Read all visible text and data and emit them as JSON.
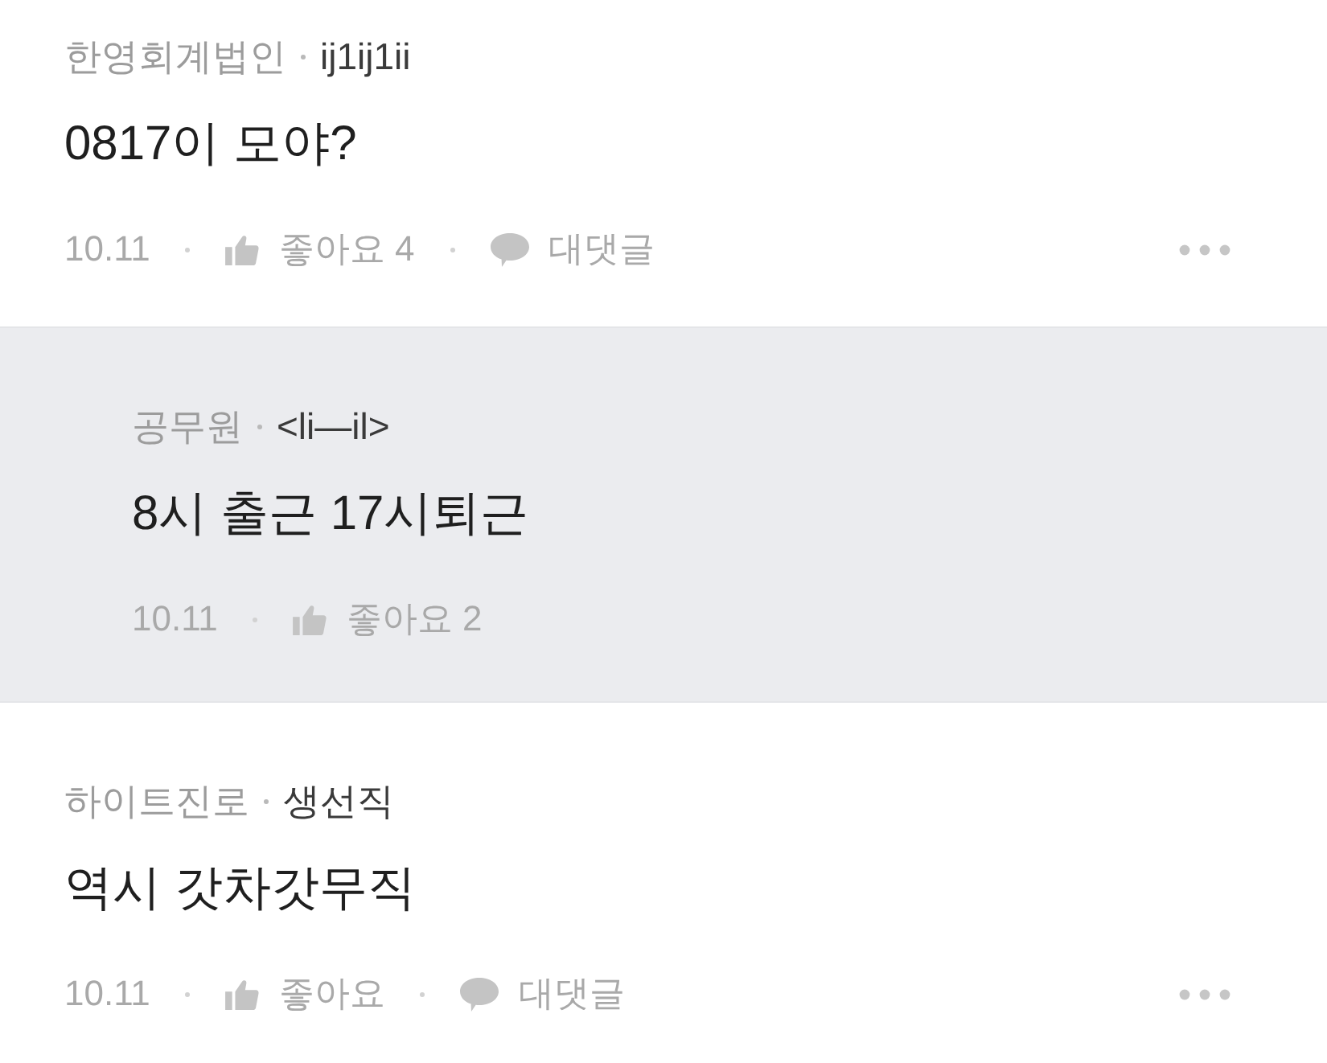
{
  "comments": [
    {
      "kind": "comment",
      "company": "한영회계법인",
      "nickname": "ij1ij1ii",
      "text": "0817이 모야?",
      "date": "10.11",
      "like_label": "좋아요",
      "like_count": "4",
      "reply_label": "대댓글"
    },
    {
      "kind": "reply",
      "company": "공무원",
      "nickname": "<li—il>",
      "text": "8시 출근 17시퇴근",
      "date": "10.11",
      "like_label": "좋아요",
      "like_count": "2"
    },
    {
      "kind": "comment",
      "company": "하이트진로",
      "nickname": "생선직",
      "text": "역시 갓차갓무직",
      "date": "10.11",
      "like_label": "좋아요",
      "reply_label": "대댓글"
    }
  ]
}
